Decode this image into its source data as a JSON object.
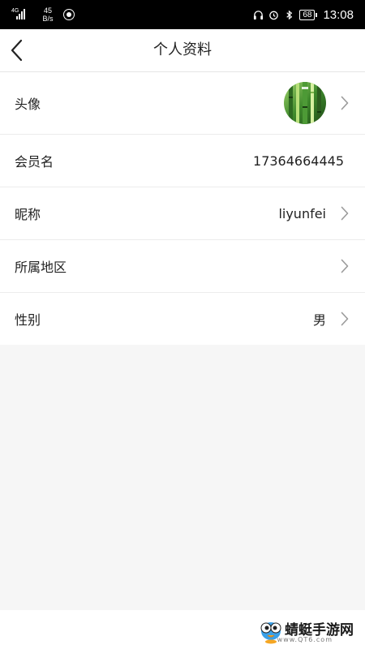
{
  "status_bar": {
    "network_type": "4G",
    "speed_value": "45",
    "speed_unit": "B/s",
    "battery": "68",
    "time": "13:08",
    "icons": [
      "signal-icon",
      "data-saver-icon",
      "headset-icon",
      "alarm-icon",
      "bluetooth-icon",
      "battery-icon"
    ]
  },
  "header": {
    "title": "个人资料",
    "back_icon": "back-arrow-icon"
  },
  "profile": {
    "rows": [
      {
        "label": "头像",
        "value": "",
        "has_arrow": true,
        "type": "avatar"
      },
      {
        "label": "会员名",
        "value": "17364664445",
        "has_arrow": false,
        "type": "text"
      },
      {
        "label": "昵称",
        "value": "liyunfei",
        "has_arrow": true,
        "type": "text"
      },
      {
        "label": "所属地区",
        "value": "",
        "has_arrow": true,
        "type": "text"
      },
      {
        "label": "性别",
        "value": "男",
        "has_arrow": true,
        "type": "text"
      }
    ]
  },
  "watermark": {
    "brand": "蜻蜓手游网",
    "site": "www.QT6.com"
  },
  "colors": {
    "background": "#f6f6f6",
    "panel": "#ffffff",
    "divider": "#ececec",
    "arrow": "#9a9a9a",
    "status_bar": "#000000"
  }
}
